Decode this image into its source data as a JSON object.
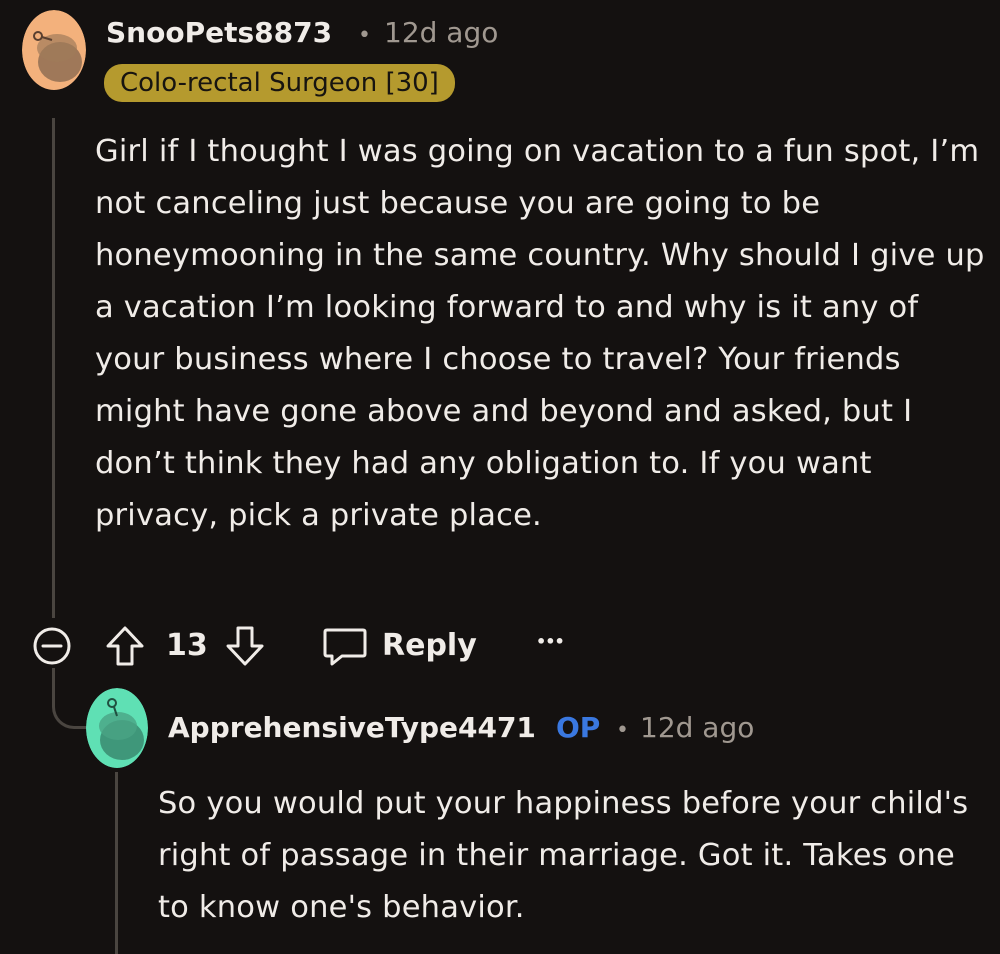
{
  "comment": {
    "username": "SnooPets8873",
    "separator": "•",
    "age": "12d ago",
    "flair": "Colo-rectal Surgeon [30]",
    "body": "Girl if I thought I was going on vacation to a fun spot, I’m not canceling just because you are going to be honeymooning in the same country. Why should I give up a vacation I’m looking forward to and why is it any of your business where I choose to travel? Your friends might have gone above and beyond and asked, but I don’t think they had any obligation to. If you want privacy, pick a private place.",
    "score": "13",
    "reply_label": "Reply",
    "more_label": "•••",
    "avatar_color": "#f3b17c"
  },
  "reply": {
    "username": "ApprehensiveType4471",
    "op_badge": "OP",
    "separator": "•",
    "age": "12d ago",
    "body": "So you would put your happiness before your child's right of passage in their marriage. Got it. Takes one to know one's behavior.",
    "avatar_color": "#5fe0b4"
  }
}
